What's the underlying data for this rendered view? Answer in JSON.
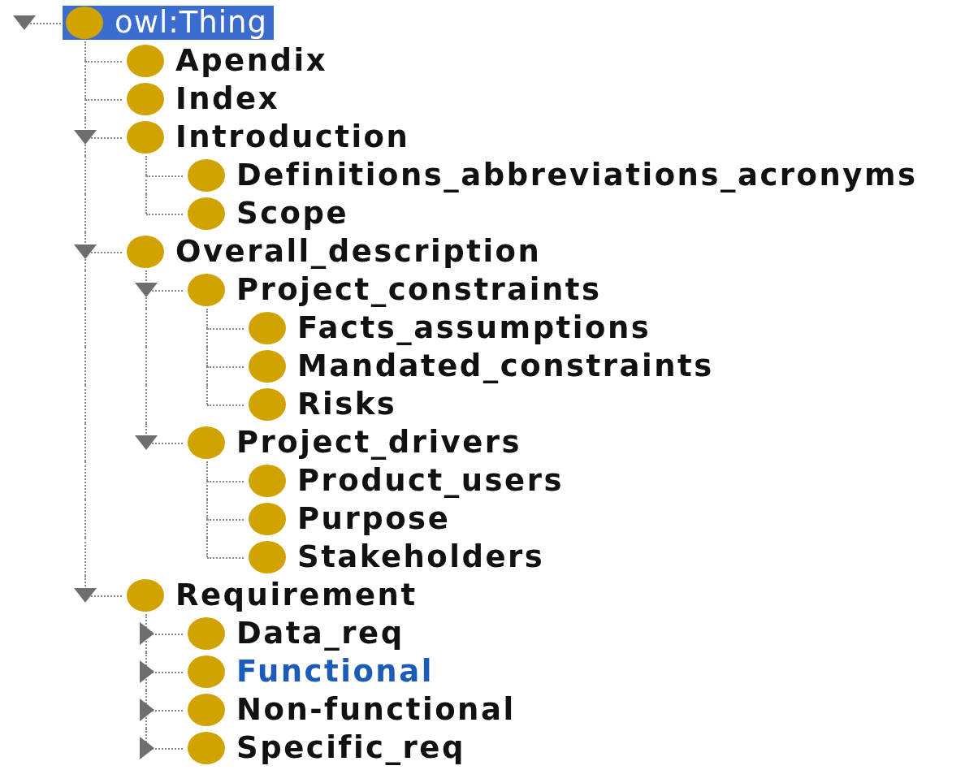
{
  "tree": {
    "label": "owl:Thing",
    "selected": true,
    "highlighted": false,
    "expanded": true,
    "children": [
      {
        "label": "Apendix",
        "selected": false,
        "highlighted": false
      },
      {
        "label": "Index",
        "selected": false,
        "highlighted": false
      },
      {
        "label": "Introduction",
        "selected": false,
        "highlighted": false,
        "expanded": true,
        "children": [
          {
            "label": "Definitions_abbreviations_acronyms",
            "selected": false,
            "highlighted": false
          },
          {
            "label": "Scope",
            "selected": false,
            "highlighted": false
          }
        ]
      },
      {
        "label": "Overall_description",
        "selected": false,
        "highlighted": false,
        "expanded": true,
        "children": [
          {
            "label": "Project_constraints",
            "selected": false,
            "highlighted": false,
            "expanded": true,
            "children": [
              {
                "label": "Facts_assumptions",
                "selected": false,
                "highlighted": false
              },
              {
                "label": "Mandated_constraints",
                "selected": false,
                "highlighted": false
              },
              {
                "label": "Risks",
                "selected": false,
                "highlighted": false
              }
            ]
          },
          {
            "label": "Project_drivers",
            "selected": false,
            "highlighted": false,
            "expanded": true,
            "children": [
              {
                "label": "Product_users",
                "selected": false,
                "highlighted": false
              },
              {
                "label": "Purpose",
                "selected": false,
                "highlighted": false
              },
              {
                "label": "Stakeholders",
                "selected": false,
                "highlighted": false
              }
            ]
          }
        ]
      },
      {
        "label": "Requirement",
        "selected": false,
        "highlighted": false,
        "expanded": true,
        "children": [
          {
            "label": "Data_req",
            "selected": false,
            "highlighted": false,
            "expanded": false
          },
          {
            "label": "Functional",
            "selected": false,
            "highlighted": true,
            "expanded": false
          },
          {
            "label": "Non-functional",
            "selected": false,
            "highlighted": false,
            "expanded": false
          },
          {
            "label": "Specific_req",
            "selected": false,
            "highlighted": false,
            "expanded": false
          }
        ]
      }
    ]
  }
}
